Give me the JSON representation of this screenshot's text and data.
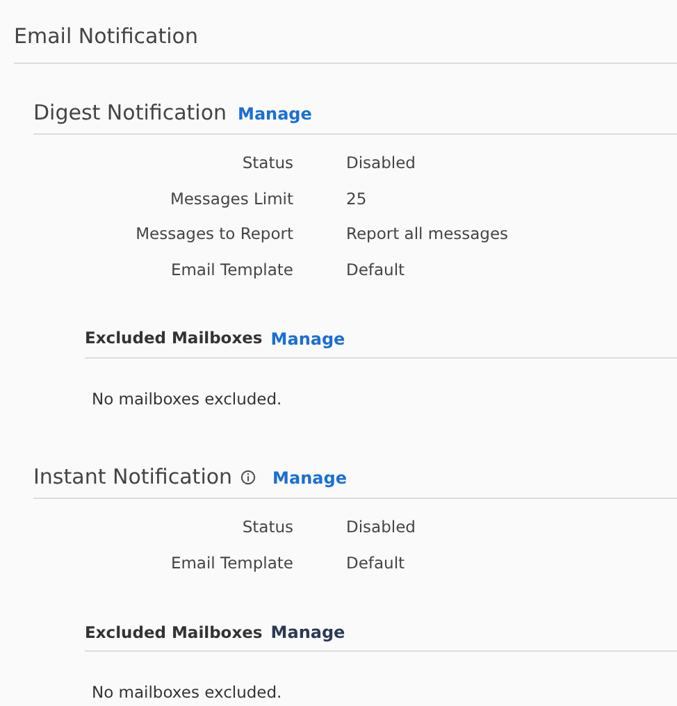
{
  "title": "Email Notification",
  "sections": [
    {
      "title": "Digest Notification",
      "info_icon": false,
      "manage": {
        "label": "Manage",
        "disabled": false
      },
      "fields": [
        {
          "label": "Status",
          "value": "Disabled"
        },
        {
          "label": "Messages Limit",
          "value": "25"
        },
        {
          "label": "Messages to Report",
          "value": "Report all messages"
        },
        {
          "label": "Email Template",
          "value": "Default"
        }
      ],
      "excluded": {
        "title": "Excluded Mailboxes",
        "manage": {
          "label": "Manage",
          "disabled": false
        },
        "empty_text": "No mailboxes excluded."
      }
    },
    {
      "title": "Instant Notification",
      "info_icon": true,
      "manage": {
        "label": "Manage",
        "disabled": false
      },
      "fields": [
        {
          "label": "Status",
          "value": "Disabled"
        },
        {
          "label": "Email Template",
          "value": "Default"
        }
      ],
      "excluded": {
        "title": "Excluded Mailboxes",
        "manage": {
          "label": "Manage",
          "disabled": true
        },
        "empty_text": "No mailboxes excluded."
      }
    }
  ]
}
